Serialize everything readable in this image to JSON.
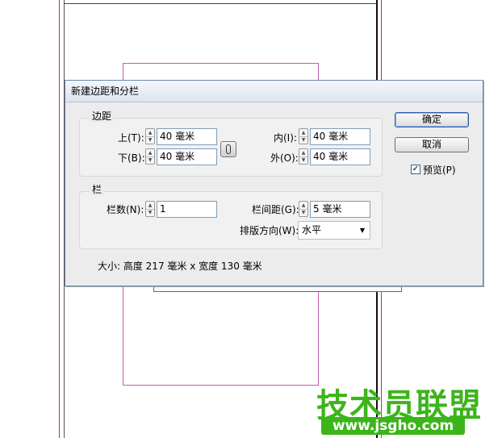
{
  "dialog": {
    "title": "新建边距和分栏",
    "margins_group": {
      "legend": "边距",
      "top": {
        "label": "上(T):",
        "value": "40 毫米"
      },
      "bottom": {
        "label": "下(B):",
        "value": "40 毫米"
      },
      "inside": {
        "label": "内(I):",
        "value": "40 毫米"
      },
      "outside": {
        "label": "外(O):",
        "value": "40 毫米"
      }
    },
    "columns_group": {
      "legend": "栏",
      "count": {
        "label": "栏数(N):",
        "value": "1"
      },
      "gutter": {
        "label": "栏间距(G):",
        "value": "5 毫米"
      },
      "direction": {
        "label": "排版方向(W):",
        "value": "水平"
      }
    },
    "size_text": "大小: 高度 217 毫米 x 宽度 130 毫米",
    "buttons": {
      "ok": "确定",
      "cancel": "取消"
    },
    "preview": {
      "label": "预览(P)",
      "checked": true
    }
  },
  "watermark": {
    "title": "技术员联盟",
    "url": "www.jsgho.com",
    "color": "#3bb51a"
  }
}
